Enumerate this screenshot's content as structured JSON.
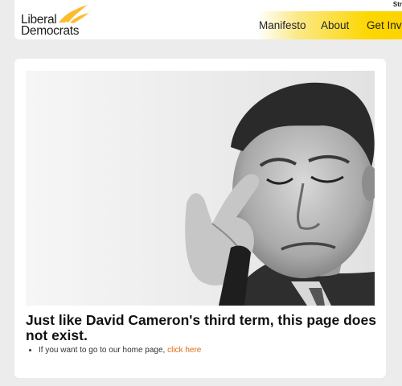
{
  "header": {
    "logo": {
      "line1": "Liberal",
      "line2": "Democrats"
    },
    "topright_text": "Str",
    "nav": [
      {
        "label": "Manifesto"
      },
      {
        "label": "About"
      },
      {
        "label": "Get Invo"
      }
    ]
  },
  "main": {
    "image_alt": "Photo of David Cameron",
    "heading": "Just like David Cameron's third term, this page does not exist.",
    "list_item": {
      "text": "If you want to go to our home page, ",
      "link": "click here"
    }
  },
  "colors": {
    "accent": "#e06c1a",
    "brand_yellow": "#fdd700",
    "background": "#ececec"
  }
}
